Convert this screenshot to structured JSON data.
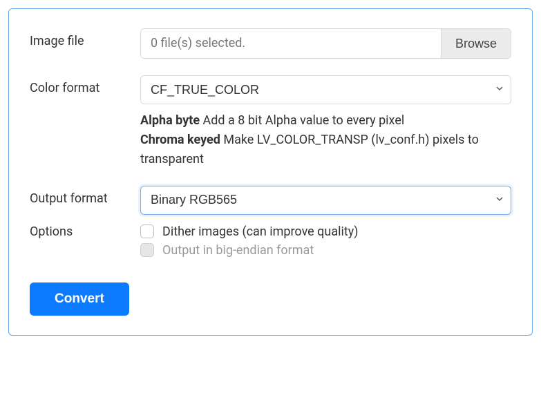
{
  "imageFile": {
    "label": "Image file",
    "statusText": "0 file(s) selected.",
    "browseLabel": "Browse"
  },
  "colorFormat": {
    "label": "Color format",
    "selected": "CF_TRUE_COLOR",
    "help": {
      "alphaTitle": "Alpha byte",
      "alphaDesc": " Add a 8 bit Alpha value to every pixel",
      "chromaTitle": "Chroma keyed",
      "chromaDesc": " Make LV_COLOR_TRANSP (lv_conf.h) pixels to transparent"
    }
  },
  "outputFormat": {
    "label": "Output format",
    "selected": "Binary RGB565"
  },
  "options": {
    "label": "Options",
    "dither": {
      "label": "Dither images (can improve quality)",
      "checked": false,
      "enabled": true
    },
    "bigEndian": {
      "label": "Output in big-endian format",
      "checked": false,
      "enabled": false
    }
  },
  "convertLabel": "Convert"
}
